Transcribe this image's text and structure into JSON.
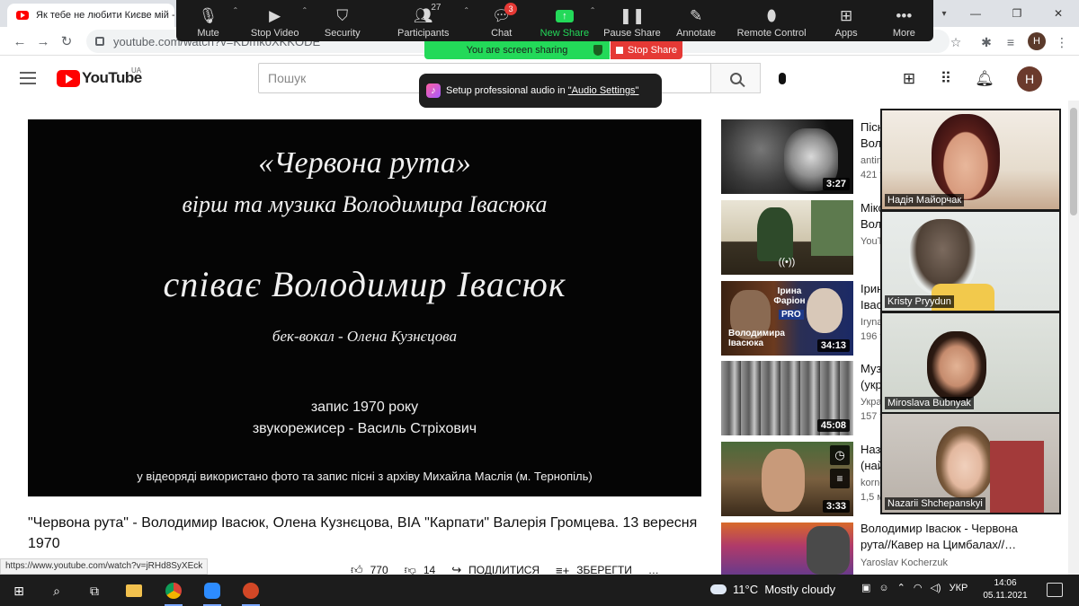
{
  "browser": {
    "tab_title": "Як тебе не любити Києве мій -",
    "window_controls": {
      "minimize": "—",
      "restore": "❐",
      "close": "✕"
    },
    "url": "youtube.com/watch?v=KDmk0XKKODE"
  },
  "zoom": {
    "toolbar": [
      {
        "label": "Mute",
        "icon": "microphone-icon"
      },
      {
        "label": "Stop Video",
        "icon": "video-camera-icon"
      },
      {
        "label": "Security",
        "icon": "shield-icon"
      },
      {
        "label": "Participants",
        "icon": "participants-icon",
        "count": "27"
      },
      {
        "label": "Chat",
        "icon": "chat-icon",
        "badge": "3"
      },
      {
        "label": "New Share",
        "icon": "share-arrow-icon"
      },
      {
        "label": "Pause Share",
        "icon": "pause-icon"
      },
      {
        "label": "Annotate",
        "icon": "pencil-icon"
      },
      {
        "label": "Remote Control",
        "icon": "mouse-icon"
      },
      {
        "label": "Apps",
        "icon": "apps-icon"
      },
      {
        "label": "More",
        "icon": "more-icon"
      }
    ],
    "sharing_label": "You are screen sharing",
    "stop_share_label": "Stop Share",
    "audio_tip": {
      "text": "Setup professional audio in",
      "link": "\"Audio Settings\""
    },
    "participants": [
      {
        "name": "Надія Майорчак"
      },
      {
        "name": "Kristy Pryydun"
      },
      {
        "name": "Miroslava  Bubnyak"
      },
      {
        "name": "Nazarii Shchepanskyi"
      }
    ],
    "colors": {
      "share_green": "#23d959",
      "stop_red": "#e53935"
    }
  },
  "youtube": {
    "logo_text": "YouTube",
    "region": "UA",
    "search_placeholder": "Пошук",
    "video": {
      "lines": [
        "«Червона рута»",
        "вірш та музика Володимира Івасюка",
        "співає Володимир Івасюк",
        "бек-вокал - Олена Кузнєцова",
        "запис 1970 року",
        "звукорежисер - Василь Стріхович",
        "у відеоряді використано фото та запис пісні з архіву Михайла Маслія (м. Тернопіль)"
      ]
    },
    "title_part1": "\"Червона рута\"",
    "title_sep": " - ",
    "title_part2": "Володимир Івасюк, Олена Кузнєцова, ВІА \"Карпати\" Валерія Громцева. 13 вересня 1970",
    "actions": {
      "likes": "770",
      "dislikes": "14",
      "share": "ПОДІЛИТИСЯ",
      "save": "ЗБЕРЕГТИ",
      "more": "…"
    },
    "status_url": "https://www.youtube.com/watch?v=jRHd8SyXEck",
    "sidebar": [
      {
        "title": "Пісн",
        "line2": "Воло",
        "meta1": "antin",
        "meta2": "421 т",
        "duration": "3:27"
      },
      {
        "title": "Мікс",
        "line2": "Воло",
        "meta1": "YouT",
        "meta2": "",
        "duration": ""
      },
      {
        "title": "Ірин",
        "line2": "Івас",
        "meta1": "Iryna",
        "meta2": "196 т",
        "duration": "34:13",
        "overlay_top": "Ірина Фаріон",
        "overlay_badge": "PRO",
        "overlay_bottom": "Володимира Івасюка"
      },
      {
        "title": "Музи",
        "line2": "(укр",
        "meta1": "Украї",
        "meta2": "157 т",
        "duration": "45:08"
      },
      {
        "title": "Назо",
        "line2": "(най",
        "meta1": "korne",
        "meta2": "1,5 м",
        "duration": "3:33"
      },
      {
        "title": "Володимир Івасюк - Червона рута//Кавер на Цимбалах//…",
        "line2": "",
        "meta1": "Yaroslav Kocherzuk",
        "meta2": "",
        "duration": ""
      }
    ]
  },
  "taskbar": {
    "weather_temp": "11°C",
    "weather_desc": "Mostly cloudy",
    "lang": "УКР",
    "time": "14:06",
    "date": "05.11.2021"
  }
}
